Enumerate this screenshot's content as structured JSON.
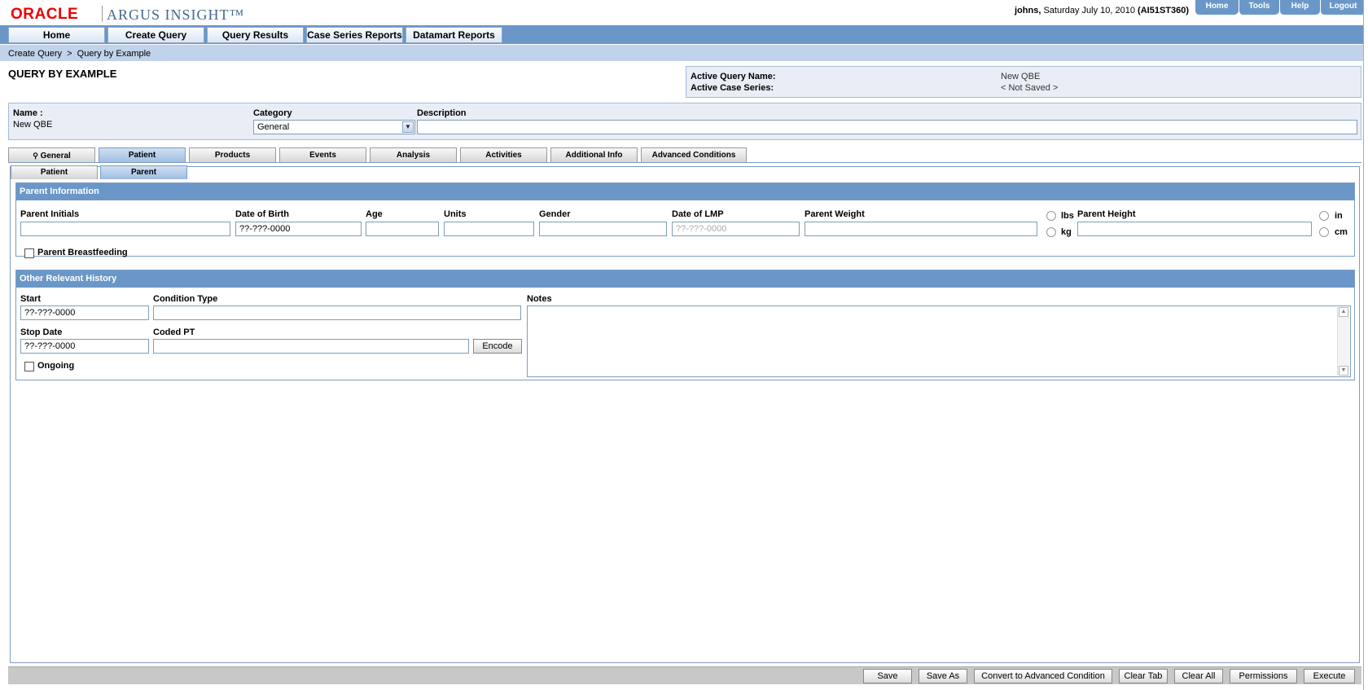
{
  "brand": {
    "oracle": "ORACLE",
    "argus": "ARGUS INSIGHT™"
  },
  "user_info": {
    "user": "johns,",
    "date": "Saturday July 10, 2010",
    "server": "(AI51ST360)"
  },
  "top_links": [
    "Home",
    "Tools",
    "Help",
    "Logout"
  ],
  "nav": [
    "Home",
    "Create Query",
    "Query Results",
    "Case Series Reports",
    "Datamart Reports"
  ],
  "breadcrumb": "Create Query  >  Query by Example",
  "page_title": "QUERY BY EXAMPLE",
  "active_query": {
    "name_label": "Active Query Name:",
    "name_value": "New QBE",
    "series_label": "Active Case Series:",
    "series_value": "< Not Saved >"
  },
  "query_info": {
    "name_label": "Name :",
    "name_value": "New QBE",
    "category_label": "Category",
    "category_value": "General",
    "description_label": "Description",
    "description_value": ""
  },
  "tabs": [
    "General",
    "Patient",
    "Products",
    "Events",
    "Analysis",
    "Activities",
    "Additional Info",
    "Advanced Conditions"
  ],
  "subtabs": [
    "Patient",
    "Parent"
  ],
  "parent_info": {
    "header": "Parent Information",
    "labels": {
      "initials": "Parent Initials",
      "dob": "Date of Birth",
      "age": "Age",
      "units": "Units",
      "gender": "Gender",
      "lmp": "Date of LMP",
      "weight": "Parent Weight",
      "height": "Parent Height",
      "lbs": "lbs",
      "kg": "kg",
      "in": "in",
      "cm": "cm",
      "breastfeeding": "Parent Breastfeeding"
    },
    "values": {
      "initials": "",
      "dob": "??-???-0000",
      "age": "",
      "units": "",
      "gender": "",
      "lmp": "??-???-0000",
      "weight": "",
      "height": ""
    }
  },
  "history": {
    "header": "Other Relevant History",
    "labels": {
      "start": "Start",
      "condition": "Condition Type",
      "notes": "Notes",
      "stop": "Stop Date",
      "coded": "Coded PT",
      "encode": "Encode",
      "ongoing": "Ongoing"
    },
    "values": {
      "start": "??-???-0000",
      "condition": "",
      "stop": "??-???-0000",
      "coded": "",
      "notes": ""
    }
  },
  "bottom_buttons": [
    "Save",
    "Save As",
    "Convert to Advanced Condition",
    "Clear Tab",
    "Clear All",
    "Permissions",
    "Execute"
  ]
}
